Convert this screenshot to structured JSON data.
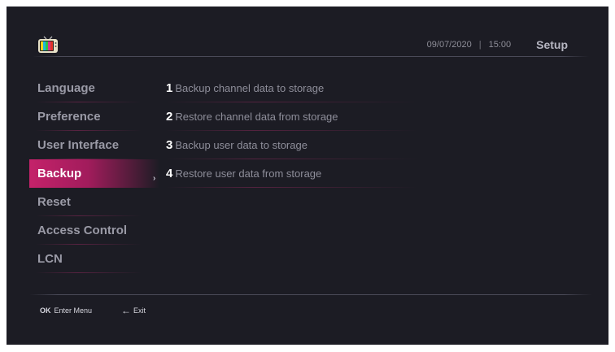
{
  "header": {
    "date": "09/07/2020",
    "separator": "|",
    "time": "15:00",
    "title": "Setup",
    "logo_icon": "tv-icon"
  },
  "menu": {
    "items": [
      {
        "label": "Language"
      },
      {
        "label": "Preference"
      },
      {
        "label": "User Interface"
      },
      {
        "label": "Backup",
        "active": true
      },
      {
        "label": "Reset"
      },
      {
        "label": "Access Control"
      },
      {
        "label": "LCN"
      }
    ],
    "active_indicator": "›"
  },
  "options": [
    {
      "number": "1",
      "label": "Backup channel data to storage"
    },
    {
      "number": "2",
      "label": "Restore channel data from storage"
    },
    {
      "number": "3",
      "label": "Backup user data to storage"
    },
    {
      "number": "4",
      "label": "Restore user data from storage"
    }
  ],
  "footer": {
    "ok_key": "OK",
    "ok_label": "Enter Menu",
    "back_icon": "←",
    "back_label": "Exit"
  },
  "colors": {
    "background": "#1c1c24",
    "accent": "#c4226a",
    "text_dim": "#9a9aa6"
  }
}
